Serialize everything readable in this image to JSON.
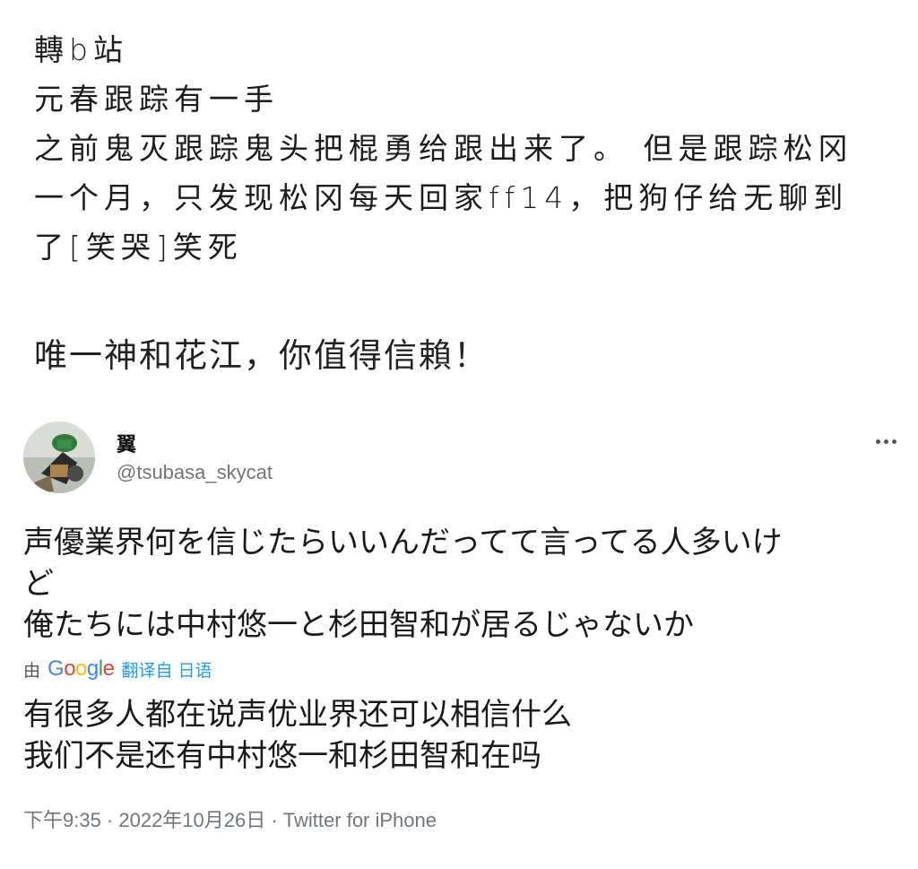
{
  "handwritten_note": {
    "lines": [
      "轉b站",
      "元春跟踪有一手",
      "之前鬼灭跟踪鬼头把棍勇给跟出来了。 但是跟踪松冈",
      "一个月，只发现松冈每天回家ff14，把狗仔给无聊到",
      "了[笑哭]笑死"
    ]
  },
  "headline": "唯一神和花江，你值得信賴！",
  "tweet": {
    "display_name": "翼",
    "handle": "@tsubasa_skycat",
    "more_icon": "more-horizontal-icon",
    "text_lines": [
      "声優業界何を信じたらいいんだってて言ってる人多いけ",
      "ど",
      "俺たちには中村悠一と杉田智和が居るじゃないか"
    ],
    "translate": {
      "prefix": "由",
      "provider": "Google",
      "label": "翻译自 日语"
    },
    "translation_lines": [
      "有很多人都在说声优业界还可以相信什么",
      "我们不是还有中村悠一和杉田智和在吗"
    ],
    "meta": "下午9:35 · 2022年10月26日 · Twitter for iPhone"
  },
  "colors": {
    "link_blue": "#1d9bf0",
    "secondary_text": "#6e767d",
    "google_blue": "#4285f4",
    "google_red": "#ea4335",
    "google_yellow": "#fbbc05",
    "google_green": "#34a853"
  }
}
